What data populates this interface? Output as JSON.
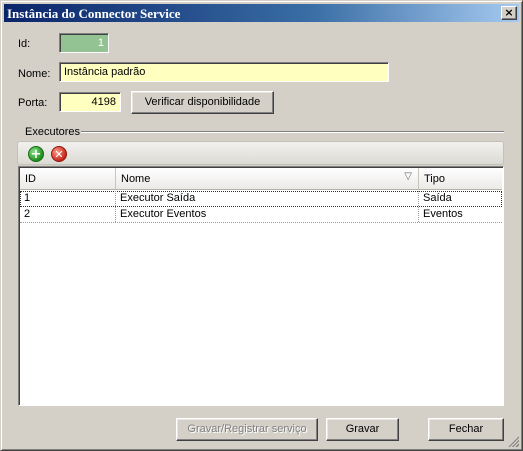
{
  "window": {
    "title": "Instância do Connector Service",
    "close_glyph": "×"
  },
  "form": {
    "id_label": "Id:",
    "id_value": "1",
    "nome_label": "Nome:",
    "nome_value": "Instância padrão",
    "porta_label": "Porta:",
    "porta_value": "4198",
    "check_button": "Verificar disponibilidade"
  },
  "executores": {
    "group_label": "Executores",
    "toolbar": {
      "add_icon": "add-icon",
      "remove_icon": "remove-icon",
      "add_glyph": "+",
      "remove_glyph": "✕"
    },
    "columns": {
      "id": "ID",
      "nome": "Nome",
      "tipo": "Tipo",
      "sort_glyph": "▽"
    },
    "rows": [
      {
        "id": "1",
        "nome": "Executor Saída",
        "tipo": "Saída"
      },
      {
        "id": "2",
        "nome": "Executor Eventos",
        "tipo": "Eventos"
      }
    ]
  },
  "buttons": {
    "gravar_registrar": "Gravar/Registrar serviço",
    "gravar": "Gravar",
    "fechar": "Fechar"
  },
  "colors": {
    "title_gradient_start": "#0a246a",
    "id_field_bg": "#93c393",
    "input_bg": "#ffffc0",
    "face": "#d4d0c8"
  }
}
